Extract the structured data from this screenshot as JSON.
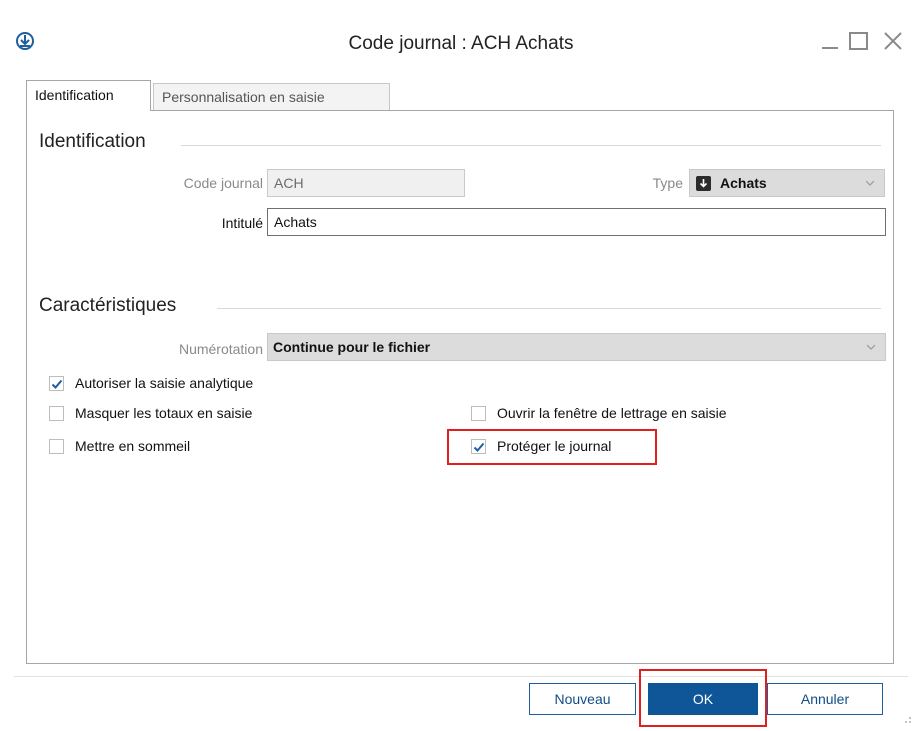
{
  "window": {
    "title": "Code journal : ACH Achats",
    "icons": [
      "app-logo-icon",
      "minimize-icon",
      "maximize-icon",
      "close-icon"
    ]
  },
  "tabs": [
    {
      "label": "Identification",
      "active": true
    },
    {
      "label": "Personnalisation en saisie",
      "active": false
    }
  ],
  "identification": {
    "section_title": "Identification",
    "code_label": "Code journal",
    "code_value": "ACH",
    "type_label": "Type",
    "type_value": "Achats",
    "type_icon": "download-arrow-icon",
    "intitule_label": "Intitulé",
    "intitule_value": "Achats"
  },
  "caracteristiques": {
    "section_title": "Caractéristiques",
    "numerotation_label": "Numérotation",
    "numerotation_value": "Continue pour le fichier",
    "checkboxes": [
      {
        "label": "Autoriser la saisie analytique",
        "checked": true
      },
      {
        "label": "Masquer les totaux en saisie",
        "checked": false
      },
      {
        "label": "Ouvrir la fenêtre de lettrage en saisie",
        "checked": false
      },
      {
        "label": "Mettre en sommeil",
        "checked": false
      },
      {
        "label": "Protéger le journal",
        "checked": true
      }
    ]
  },
  "footer": {
    "nouveau": "Nouveau",
    "ok": "OK",
    "annuler": "Annuler"
  },
  "colors": {
    "accent": "#0f5699",
    "highlight": "#e02020",
    "check": "#1f5f9f"
  }
}
